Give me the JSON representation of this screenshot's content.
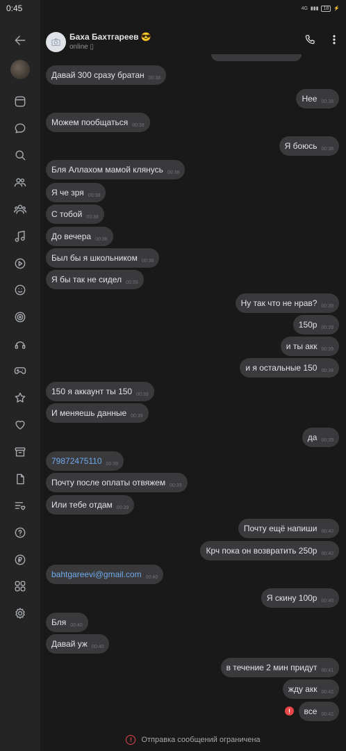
{
  "status_bar": {
    "time": "0:45",
    "signal": "4G",
    "battery": "18"
  },
  "sidebar": {
    "items": [
      {
        "icon": "arrow-left-icon"
      },
      {
        "icon": "avatar"
      },
      {
        "icon": "news-icon"
      },
      {
        "icon": "messages-icon"
      },
      {
        "icon": "search-icon"
      },
      {
        "icon": "friends-icon"
      },
      {
        "icon": "communities-icon"
      },
      {
        "icon": "music-icon"
      },
      {
        "icon": "video-icon"
      },
      {
        "icon": "stickers-icon"
      },
      {
        "icon": "target-icon"
      },
      {
        "icon": "podcasts-icon"
      },
      {
        "icon": "games-icon"
      },
      {
        "icon": "bookmarks-icon"
      },
      {
        "icon": "likes-icon"
      },
      {
        "icon": "archive-icon"
      },
      {
        "icon": "documents-icon"
      },
      {
        "icon": "lists-icon"
      },
      {
        "icon": "help-icon"
      },
      {
        "icon": "payments-icon"
      },
      {
        "icon": "services-icon"
      },
      {
        "icon": "settings-icon"
      }
    ]
  },
  "header": {
    "name": "Баха Бахтгареев 😎",
    "status": "online ▯",
    "call_icon": "phone-icon",
    "menu_icon": "more-vertical-icon"
  },
  "messages": [
    {
      "dir": "in",
      "text": "Давай 300 сразу братан",
      "time": "00:38"
    },
    {
      "dir": "out",
      "text": "Нее",
      "time": "00:38"
    },
    {
      "dir": "in",
      "text": "Можем пообщаться",
      "time": "00:38"
    },
    {
      "dir": "out",
      "text": "Я боюсь",
      "time": "00:38"
    },
    {
      "dir": "in",
      "text": "Бля Аллахом мамой клянусь",
      "time": "00:38"
    },
    {
      "dir": "in",
      "text": "Я че зря",
      "time": "00:38"
    },
    {
      "dir": "in",
      "text": "С тобой",
      "time": "00:38"
    },
    {
      "dir": "in",
      "text": "До вечера",
      "time": "00:38"
    },
    {
      "dir": "in",
      "text": "Был бы я школьником",
      "time": "00:38"
    },
    {
      "dir": "in",
      "text": "Я бы так не сидел",
      "time": "00:39"
    },
    {
      "dir": "out",
      "text": "Ну так что не нрав?",
      "time": "00:39"
    },
    {
      "dir": "out",
      "text": "150р",
      "time": "00:39"
    },
    {
      "dir": "out",
      "text": "и ты акк",
      "time": "00:39"
    },
    {
      "dir": "out",
      "text": "и я остальные 150",
      "time": "00:39"
    },
    {
      "dir": "in",
      "text": "150 я аккаунт ты 150",
      "time": "00:39"
    },
    {
      "dir": "in",
      "text": "И меняешь данные",
      "time": "00:39"
    },
    {
      "dir": "out",
      "text": "да",
      "time": "00:39"
    },
    {
      "dir": "in",
      "text": "79872475110",
      "time": "00:39",
      "link": true
    },
    {
      "dir": "in",
      "text": "Почту после оплаты отвяжем",
      "time": "00:39"
    },
    {
      "dir": "in",
      "text": "Или тебе отдам",
      "time": "00:39"
    },
    {
      "dir": "out",
      "text": "Почту ещё напиши",
      "time": "00:40"
    },
    {
      "dir": "out",
      "text": "Крч пока он возвратить 250р",
      "time": "00:40"
    },
    {
      "dir": "in",
      "text": "bahtgareevi@gmail.com",
      "time": "00:40",
      "link": true
    },
    {
      "dir": "out",
      "text": "Я скину 100р",
      "time": "00:40"
    },
    {
      "dir": "in",
      "text": "Бля",
      "time": "00:40"
    },
    {
      "dir": "in",
      "text": "Давай уж",
      "time": "00:40"
    },
    {
      "dir": "out",
      "text": "в течение 2 мин придут",
      "time": "00:41"
    },
    {
      "dir": "out",
      "text": "жду акк",
      "time": "00:42"
    },
    {
      "dir": "out",
      "text": "все",
      "time": "00:42",
      "error": "!"
    }
  ],
  "footer": {
    "icon": "!",
    "text": "Отправка сообщений ограничена"
  }
}
